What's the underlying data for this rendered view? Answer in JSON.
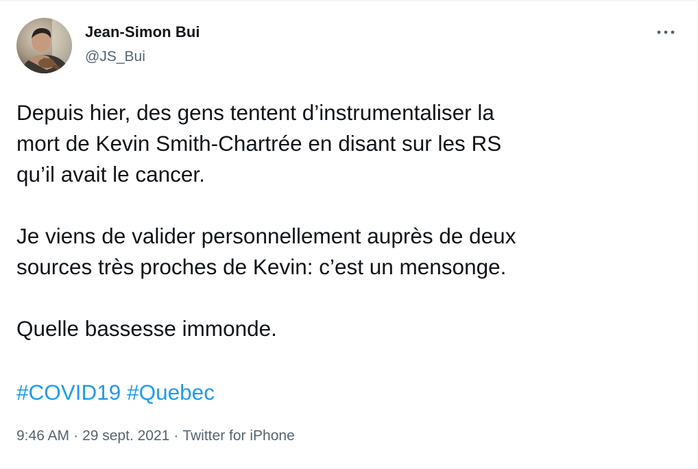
{
  "author": {
    "display_name": "Jean-Simon Bui",
    "handle": "@JS_Bui"
  },
  "icons": {
    "avatar": "profile-photo",
    "more": "more-horizontal-icon"
  },
  "tweet": {
    "paragraphs": [
      {
        "lines": [
          "Depuis hier, des gens tentent d’instrumentaliser la",
          "mort de Kevin Smith-Chartrée en disant sur les RS",
          "qu’il avait le cancer."
        ]
      },
      {
        "lines": [
          "Je viens de valider personnellement auprès de deux",
          "sources très proches de Kevin: c’est un mensonge."
        ]
      },
      {
        "lines": [
          "Quelle bassesse immonde."
        ]
      }
    ],
    "hashtags": [
      "#COVID19",
      "#Quebec"
    ]
  },
  "meta": {
    "time": "9:46 AM",
    "separator": "·",
    "date": "29 sept. 2021",
    "source": "Twitter for iPhone"
  },
  "colors": {
    "text": "#0f1419",
    "secondary": "#536471",
    "link": "#1d9bf0"
  }
}
